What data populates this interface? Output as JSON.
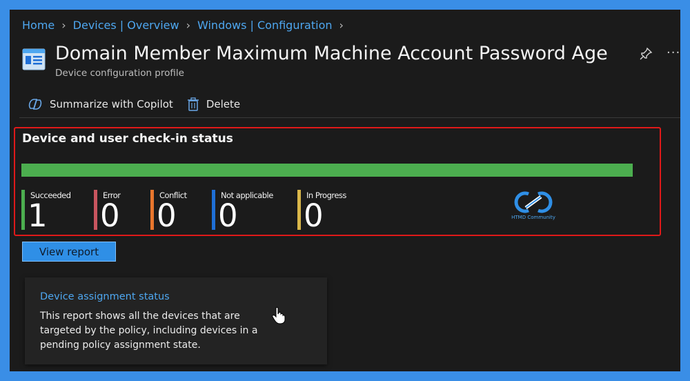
{
  "breadcrumb": {
    "items": [
      "Home",
      "Devices | Overview",
      "Windows | Configuration"
    ]
  },
  "header": {
    "title": "Domain Member Maximum Machine Account Password Age",
    "subtitle": "Device configuration profile",
    "more_label": "···"
  },
  "toolbar": {
    "summarize_label": "Summarize with Copilot",
    "delete_label": "Delete"
  },
  "checkin": {
    "title": "Device and user check-in status",
    "progress_fraction": 1.0,
    "progress_color": "#4cae4f",
    "counters": [
      {
        "label": "Succeeded",
        "value": "1",
        "color": "#4cae4f"
      },
      {
        "label": "Error",
        "value": "0",
        "color": "#c8555f"
      },
      {
        "label": "Conflict",
        "value": "0",
        "color": "#e8762d"
      },
      {
        "label": "Not applicable",
        "value": "0",
        "color": "#1f6fd6"
      },
      {
        "label": "In Progress",
        "value": "0",
        "color": "#d9b74a"
      }
    ],
    "logo_text": "HTMD Community"
  },
  "actions": {
    "view_report_label": "View report"
  },
  "assignment_card": {
    "title": "Device assignment status",
    "description": "This report shows all the devices that are targeted by the policy, including devices in a pending policy assignment state."
  },
  "colors": {
    "accent": "#4ea7f0",
    "highlight_border": "#e01919",
    "background": "#1b1b1b"
  }
}
